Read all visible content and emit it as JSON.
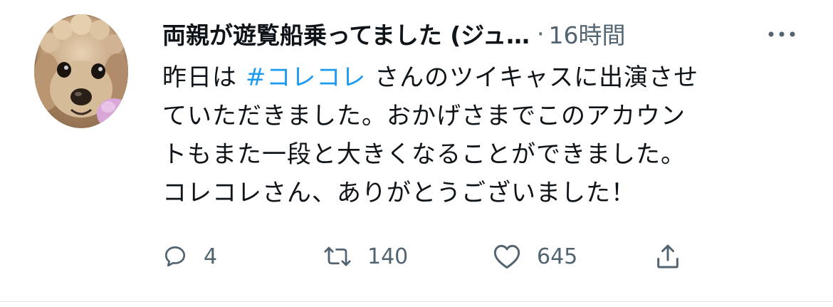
{
  "tweet": {
    "display_name": "両親が遊覧船乗ってました (ジュ…",
    "separator": "·",
    "time": "16時間",
    "text_lines": [
      {
        "before": "昨日は ",
        "hashtag": "#コレコレ",
        "after": " さんのツイキャスに出演させ"
      },
      {
        "text": "ていただきました。おかげさまでこのアカウン"
      },
      {
        "text": "トもまた一段と大きくなることができました。"
      },
      {
        "text": "コレコレさん、ありがとうございました！"
      }
    ],
    "actions": {
      "reply_count": "4",
      "retweet_count": "140",
      "like_count": "645"
    }
  },
  "icons": {
    "more": "more-horizontal-icon",
    "reply": "reply-icon",
    "retweet": "retweet-icon",
    "like": "heart-icon",
    "share": "share-icon"
  },
  "colors": {
    "text": "#0f1419",
    "secondary": "#536471",
    "hashtag": "#1d9bf0",
    "divider": "#e6e9ec"
  }
}
